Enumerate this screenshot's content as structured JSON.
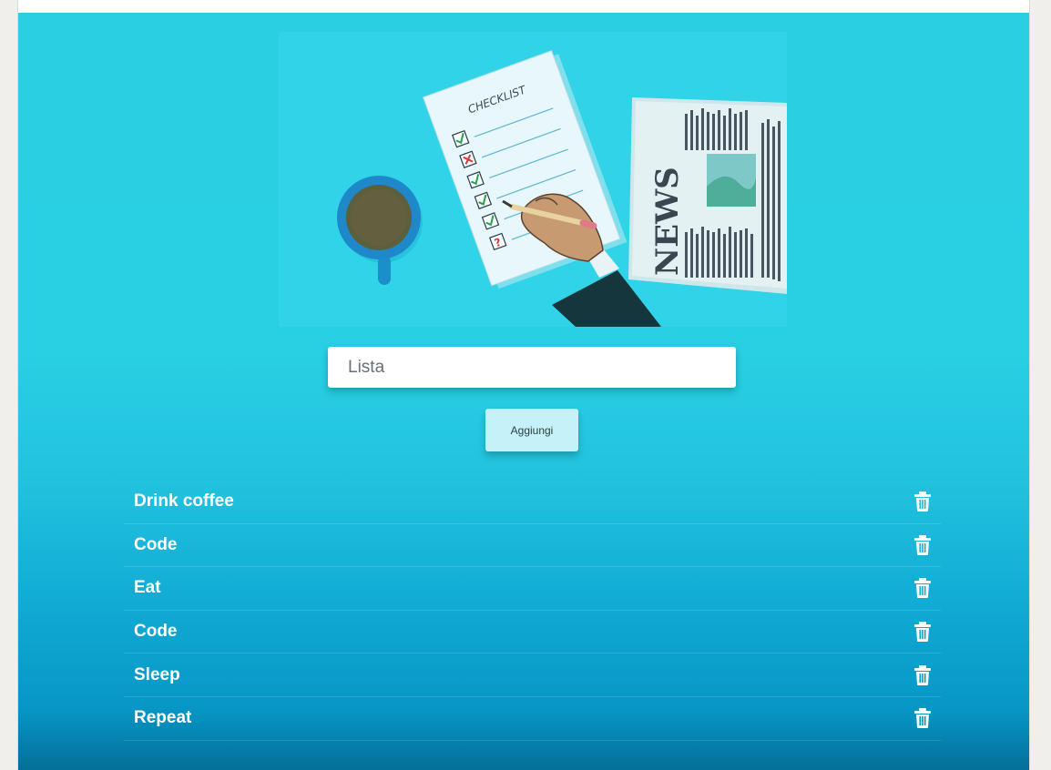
{
  "input": {
    "placeholder": "Lista",
    "value": ""
  },
  "add_button": {
    "label": "Aggiungi"
  },
  "illustration": {
    "checklist_label": "CHECKLIST",
    "newspaper_label": "NEWS",
    "checklist_marks": [
      "check",
      "cross",
      "check",
      "check",
      "check",
      "question"
    ]
  },
  "tasks": [
    {
      "label": "Drink coffee",
      "icon": "trash-icon"
    },
    {
      "label": "Code",
      "icon": "trash-icon"
    },
    {
      "label": "Eat",
      "icon": "trash-icon"
    },
    {
      "label": "Code",
      "icon": "trash-icon"
    },
    {
      "label": "Sleep",
      "icon": "trash-icon"
    },
    {
      "label": "Repeat",
      "icon": "trash-icon"
    }
  ],
  "colors": {
    "background_top": "#2ad0e2",
    "background_bottom": "#046f99",
    "button_bg": "#c5f1f8",
    "text": "#ffffff"
  }
}
